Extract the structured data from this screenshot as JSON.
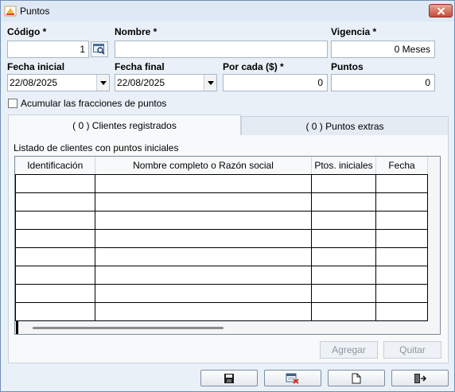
{
  "window": {
    "title": "Puntos"
  },
  "form": {
    "codigo": {
      "label": "Código *",
      "value": "1"
    },
    "nombre": {
      "label": "Nombre *",
      "value": ""
    },
    "vigencia": {
      "label": "Vigencia *",
      "value": "0 Meses"
    },
    "fecha_inicial": {
      "label": "Fecha inicial",
      "value": "22/08/2025"
    },
    "fecha_final": {
      "label": "Fecha final",
      "value": "22/08/2025"
    },
    "por_cada": {
      "label": "Por cada ($) *",
      "value": "0"
    },
    "puntos": {
      "label": "Puntos",
      "value": "0"
    },
    "acumular": {
      "label": "Acumular las fracciones de puntos",
      "checked": false
    }
  },
  "tabs": [
    {
      "label": "( 0 ) Clientes registrados",
      "active": true
    },
    {
      "label": "( 0 ) Puntos extras",
      "active": false
    }
  ],
  "grid": {
    "caption": "Listado de clientes con puntos iniciales",
    "columns": [
      "Identificación",
      "Nombre completo o Razón social",
      "Ptos. iniciales",
      "Fecha"
    ],
    "rows": 8
  },
  "buttons": {
    "agregar": "Agregar",
    "quitar": "Quitar"
  },
  "toolbar": [
    "save-icon",
    "discard-icon",
    "new-document-icon",
    "exit-icon"
  ]
}
